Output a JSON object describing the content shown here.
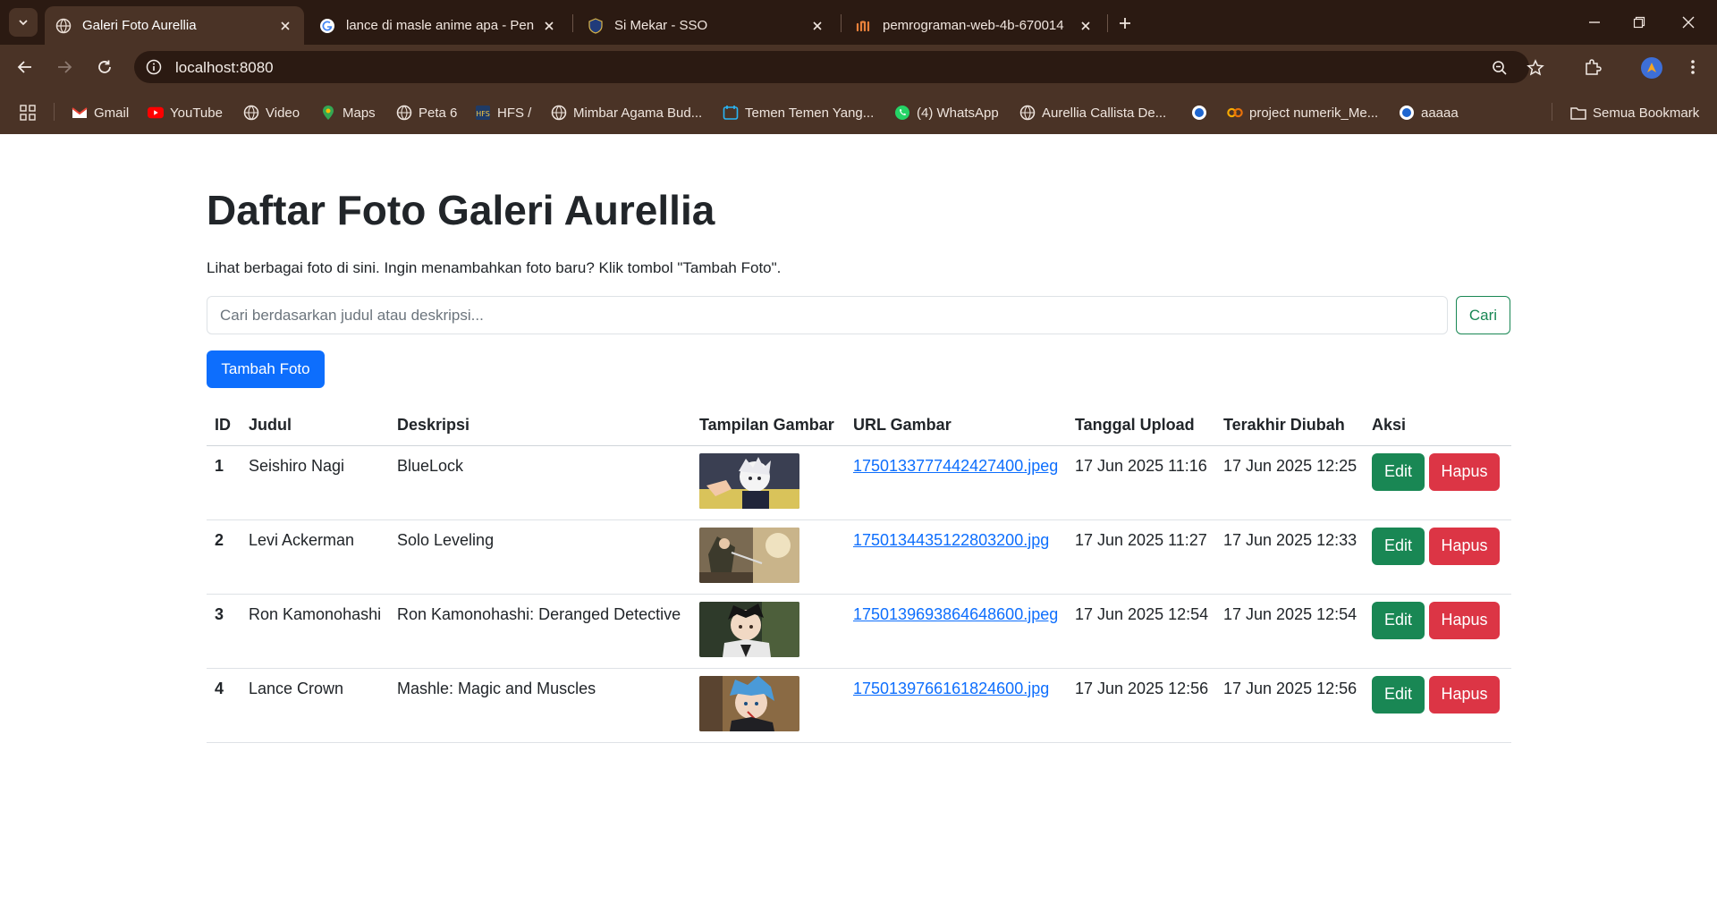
{
  "browser": {
    "tabs": [
      {
        "title": "Galeri Foto Aurellia",
        "active": true,
        "icon": "globe-icon"
      },
      {
        "title": "lance di masle anime apa - Pen",
        "active": false,
        "icon": "google-icon"
      },
      {
        "title": "Si Mekar - SSO",
        "active": false,
        "icon": "shield-icon"
      },
      {
        "title": "pemrograman-web-4b-670014",
        "active": false,
        "icon": "notion-like-icon"
      }
    ],
    "url": "localhost:8080",
    "bookmarks": [
      {
        "label": "Gmail",
        "icon": "gmail-icon"
      },
      {
        "label": "YouTube",
        "icon": "youtube-icon"
      },
      {
        "label": "Video",
        "icon": "globe-icon"
      },
      {
        "label": "Maps",
        "icon": "maps-pin-icon"
      },
      {
        "label": "Peta 6",
        "icon": "globe-icon"
      },
      {
        "label": "HFS /",
        "icon": "hfs-icon"
      },
      {
        "label": "Mimbar Agama Bud...",
        "icon": "globe-icon"
      },
      {
        "label": "Temen Temen Yang...",
        "icon": "calendar-icon"
      },
      {
        "label": "(4) WhatsApp",
        "icon": "whatsapp-icon"
      },
      {
        "label": "Aurellia Callista De...",
        "icon": "globe-icon"
      },
      {
        "label": "",
        "icon": "circle-app-icon"
      },
      {
        "label": "project numerik_Me...",
        "icon": "colab-icon"
      },
      {
        "label": "aaaaa",
        "icon": "circle-app-icon"
      }
    ],
    "all_bookmarks": "Semua Bookmark",
    "colors": {
      "frame": "#2b1a12",
      "toolbar": "#4a3326"
    }
  },
  "page": {
    "title": "Daftar Foto Galeri Aurellia",
    "description": "Lihat berbagai foto di sini. Ingin menambahkan foto baru? Klik tombol \"Tambah Foto\".",
    "search": {
      "placeholder": "Cari berdasarkan judul atau deskripsi...",
      "value": "",
      "button": "Cari"
    },
    "add_button": "Tambah Foto",
    "table": {
      "headers": [
        "ID",
        "Judul",
        "Deskripsi",
        "Tampilan Gambar",
        "URL Gambar",
        "Tanggal Upload",
        "Terakhir Diubah",
        "Aksi"
      ],
      "rows": [
        {
          "id": "1",
          "judul": "Seishiro Nagi",
          "deskripsi": "BlueLock",
          "url": "1750133777442427400.jpeg",
          "uploaded": "17 Jun 2025 11:16",
          "updated": "17 Jun 2025 12:25",
          "edit": "Edit",
          "delete": "Hapus"
        },
        {
          "id": "2",
          "judul": "Levi Ackerman",
          "deskripsi": "Solo Leveling",
          "url": "1750134435122803200.jpg",
          "uploaded": "17 Jun 2025 11:27",
          "updated": "17 Jun 2025 12:33",
          "edit": "Edit",
          "delete": "Hapus"
        },
        {
          "id": "3",
          "judul": "Ron Kamonohashi",
          "deskripsi": "Ron Kamonohashi: Deranged Detective",
          "url": "1750139693864648600.jpeg",
          "uploaded": "17 Jun 2025 12:54",
          "updated": "17 Jun 2025 12:54",
          "edit": "Edit",
          "delete": "Hapus"
        },
        {
          "id": "4",
          "judul": "Lance Crown",
          "deskripsi": "Mashle: Magic and Muscles",
          "url": "1750139766161824600.jpg",
          "uploaded": "17 Jun 2025 12:56",
          "updated": "17 Jun 2025 12:56",
          "edit": "Edit",
          "delete": "Hapus"
        }
      ]
    },
    "colors": {
      "primary": "#0d6efd",
      "success": "#198754",
      "danger": "#dc3545"
    }
  }
}
